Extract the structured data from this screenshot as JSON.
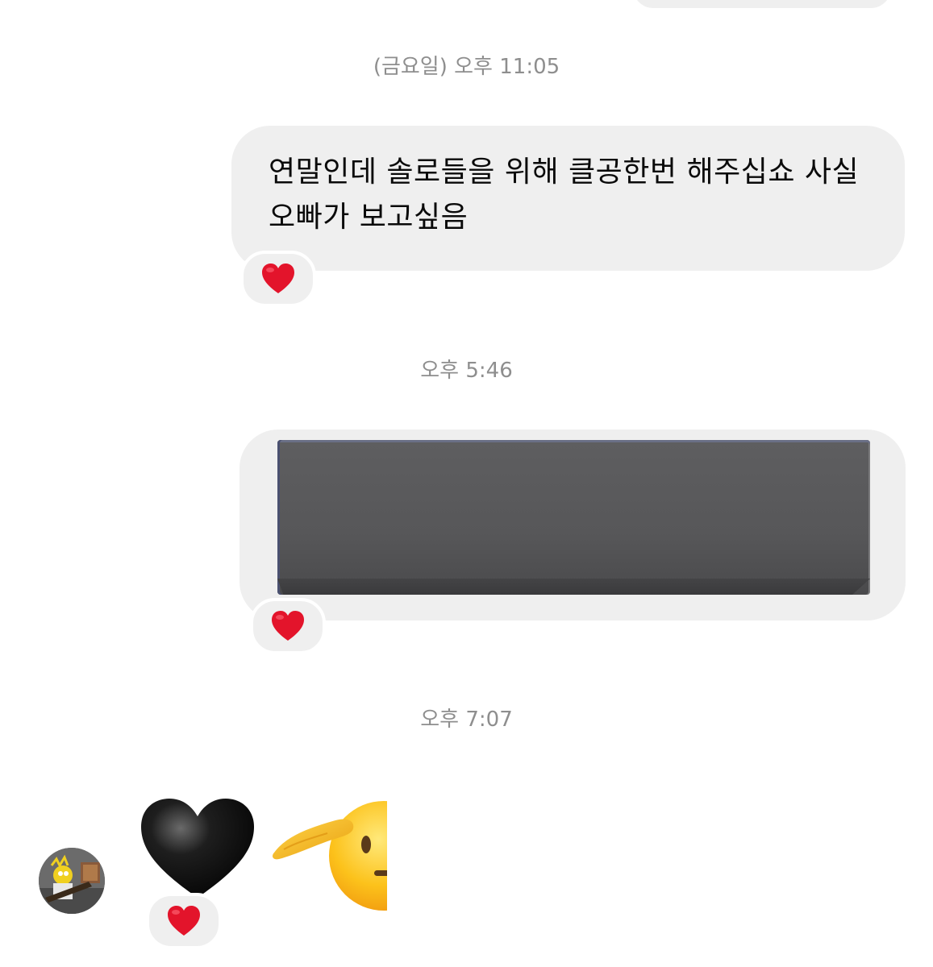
{
  "thread": {
    "timestamps": {
      "t1": "(금요일) 오후 11:05",
      "t2": "오후 5:46",
      "t3": "오후 7:07"
    },
    "messages": {
      "text_message": "연말인데 솔로들을 위해 클공한번 해주십쇼 사실 오빠가 보고싶음"
    },
    "reactions": {
      "icon": "red-heart-icon"
    },
    "incoming": {
      "emoji_1": "black-heart-icon",
      "emoji_2": "saluting-face-icon"
    }
  },
  "colors": {
    "bubble_bg": "#efefef",
    "timestamp_text": "#8e8e8e",
    "message_text": "#0a0a0a",
    "heart_red": "#e3142b"
  }
}
